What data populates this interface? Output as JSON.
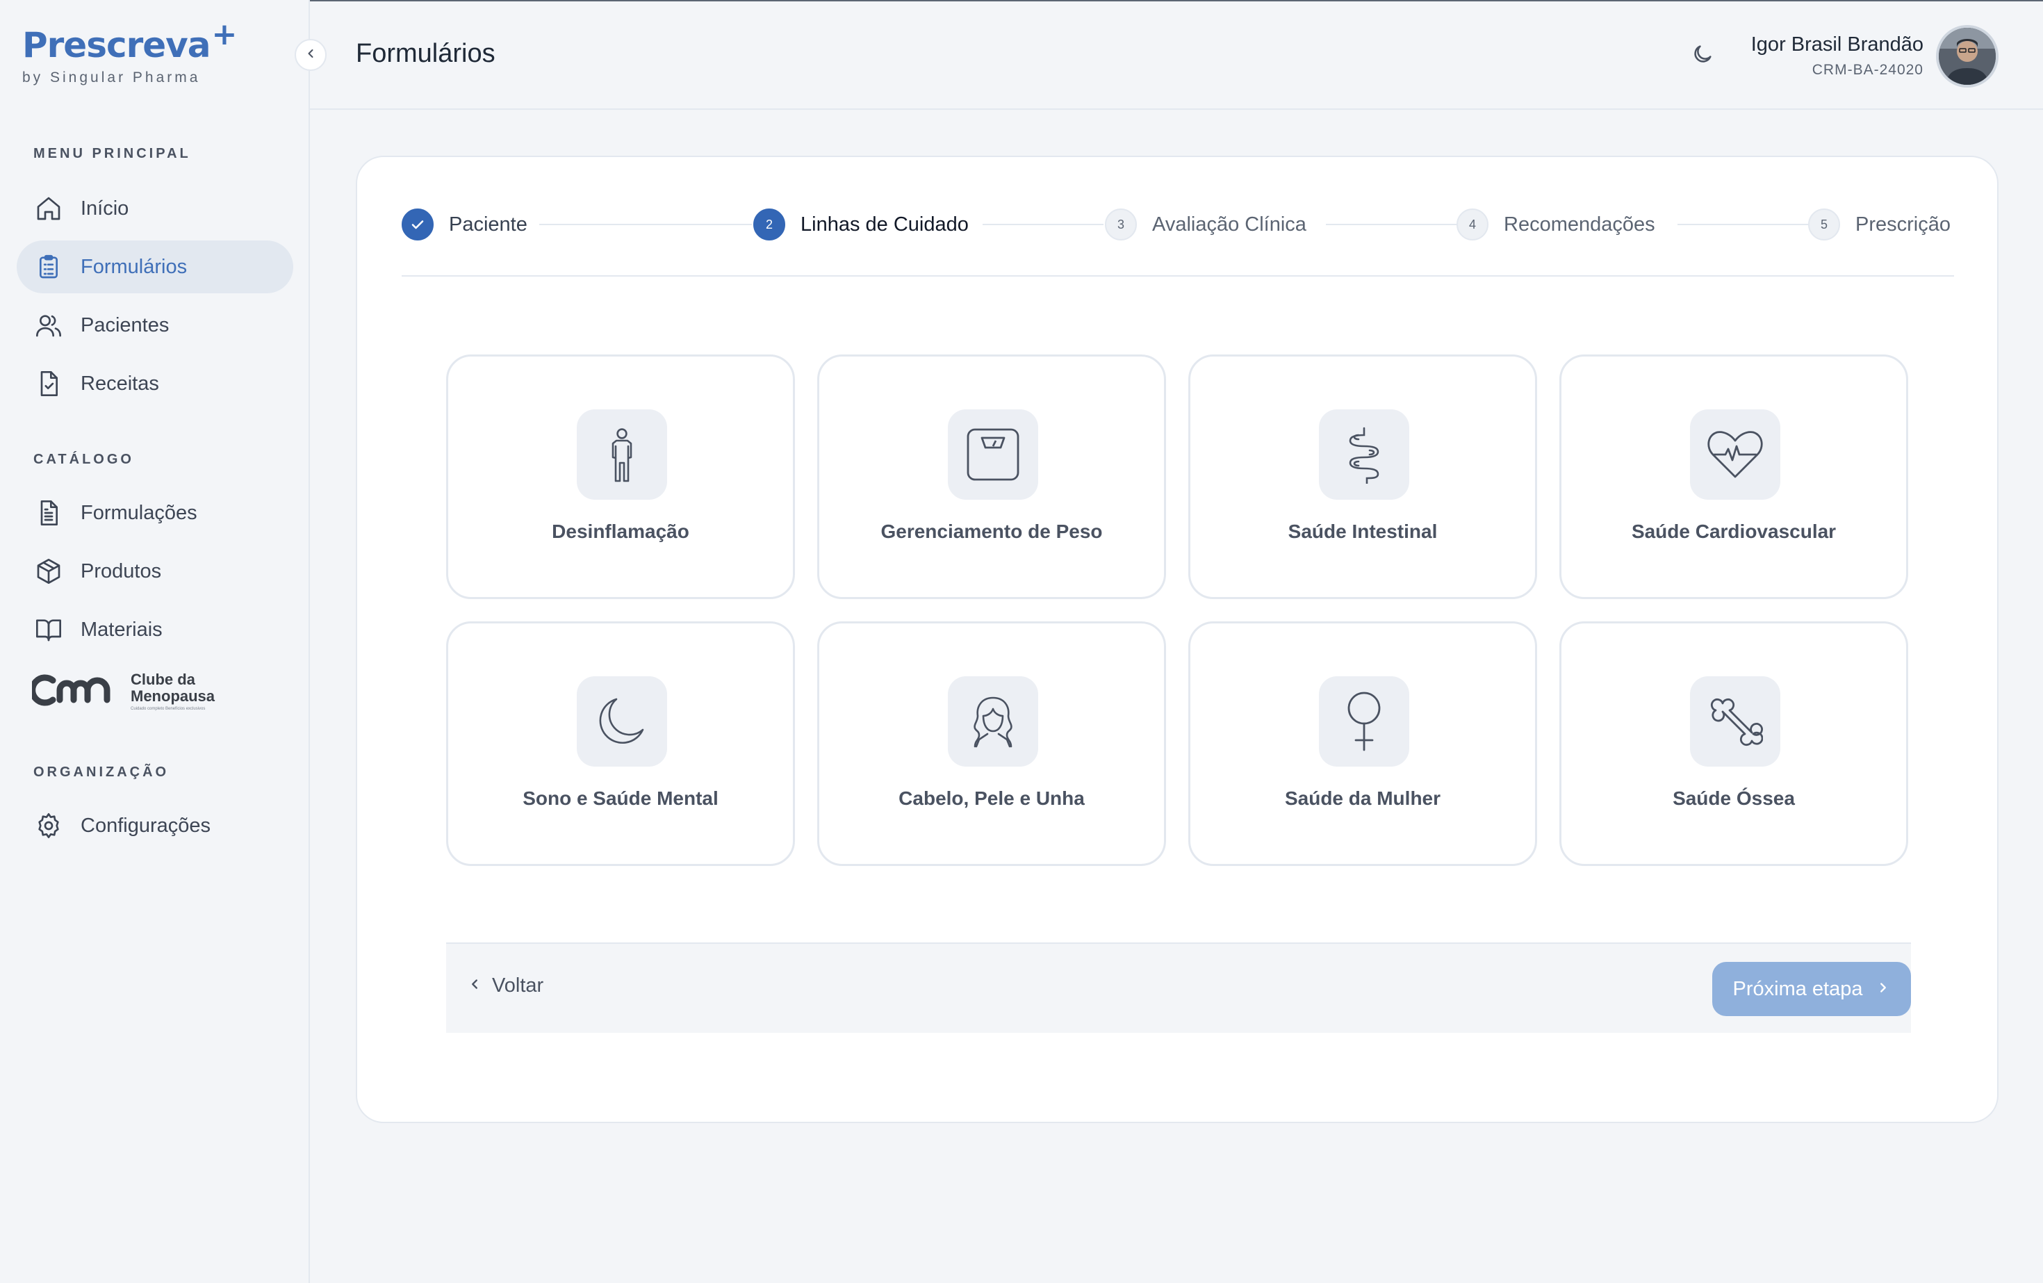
{
  "brand": {
    "name": "Prescreva",
    "plus": "+",
    "sub": "by Singular Pharma"
  },
  "sidebar": {
    "menu_title": "MENU PRINCIPAL",
    "menu": [
      {
        "label": "Início",
        "icon": "home-icon",
        "active": false
      },
      {
        "label": "Formulários",
        "icon": "clipboard-list-icon",
        "active": true
      },
      {
        "label": "Pacientes",
        "icon": "users-icon",
        "active": false
      },
      {
        "label": "Receitas",
        "icon": "file-check-icon",
        "active": false
      }
    ],
    "catalog_title": "CATÁLOGO",
    "catalog": [
      {
        "label": "Formulações",
        "icon": "file-text-icon"
      },
      {
        "label": "Produtos",
        "icon": "package-icon"
      },
      {
        "label": "Materiais",
        "icon": "book-open-icon"
      }
    ],
    "clube": {
      "line1": "Clube da",
      "line2": "Menopausa",
      "tagline": "Cuidado completo Benefícios exclusivos"
    },
    "org_title": "ORGANIZAÇÃO",
    "org": [
      {
        "label": "Configurações",
        "icon": "gear-icon"
      }
    ]
  },
  "header": {
    "title": "Formulários",
    "user_name": "Igor Brasil Brandão",
    "user_crm": "CRM-BA-24020"
  },
  "stepper": {
    "steps": [
      {
        "num": "",
        "label": "Paciente",
        "state": "done"
      },
      {
        "num": "2",
        "label": "Linhas de Cuidado",
        "state": "current"
      },
      {
        "num": "3",
        "label": "Avaliação Clínica",
        "state": "pending"
      },
      {
        "num": "4",
        "label": "Recomendações",
        "state": "pending"
      },
      {
        "num": "5",
        "label": "Prescrição",
        "state": "pending"
      }
    ]
  },
  "care_lines": [
    {
      "label": "Desinflamação",
      "icon": "human-body-icon"
    },
    {
      "label": "Gerenciamento de Peso",
      "icon": "scale-icon"
    },
    {
      "label": "Saúde Intestinal",
      "icon": "intestine-icon"
    },
    {
      "label": "Saúde Cardiovascular",
      "icon": "heart-pulse-icon"
    },
    {
      "label": "Sono e Saúde Mental",
      "icon": "moon-icon"
    },
    {
      "label": "Cabelo, Pele e Unha",
      "icon": "woman-hair-icon"
    },
    {
      "label": "Saúde da Mulher",
      "icon": "venus-icon"
    },
    {
      "label": "Saúde Óssea",
      "icon": "bone-icon"
    }
  ],
  "footer": {
    "back_label": "Voltar",
    "next_label": "Próxima etapa"
  },
  "colors": {
    "accent": "#3366b5",
    "active_nav_bg": "#e2e8f0",
    "next_disabled": "#8fb0dc",
    "tile_border": "#e3e8ef"
  }
}
